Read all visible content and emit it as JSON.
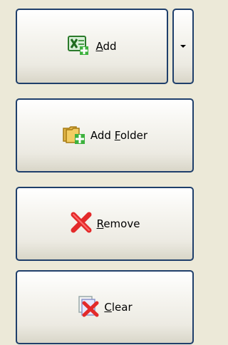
{
  "buttons": {
    "add": {
      "pre": "",
      "key": "A",
      "post": "dd"
    },
    "folder": {
      "pre": "Add ",
      "key": "F",
      "post": "older"
    },
    "remove": {
      "pre": "",
      "key": "R",
      "post": "emove"
    },
    "clear": {
      "pre": "",
      "key": "C",
      "post": "lear"
    }
  },
  "icons": {
    "add": "excel-add-icon",
    "folder": "folder-add-icon",
    "remove": "red-x-icon",
    "clear": "clear-icon",
    "dropdown": "dropdown-arrow-icon"
  }
}
